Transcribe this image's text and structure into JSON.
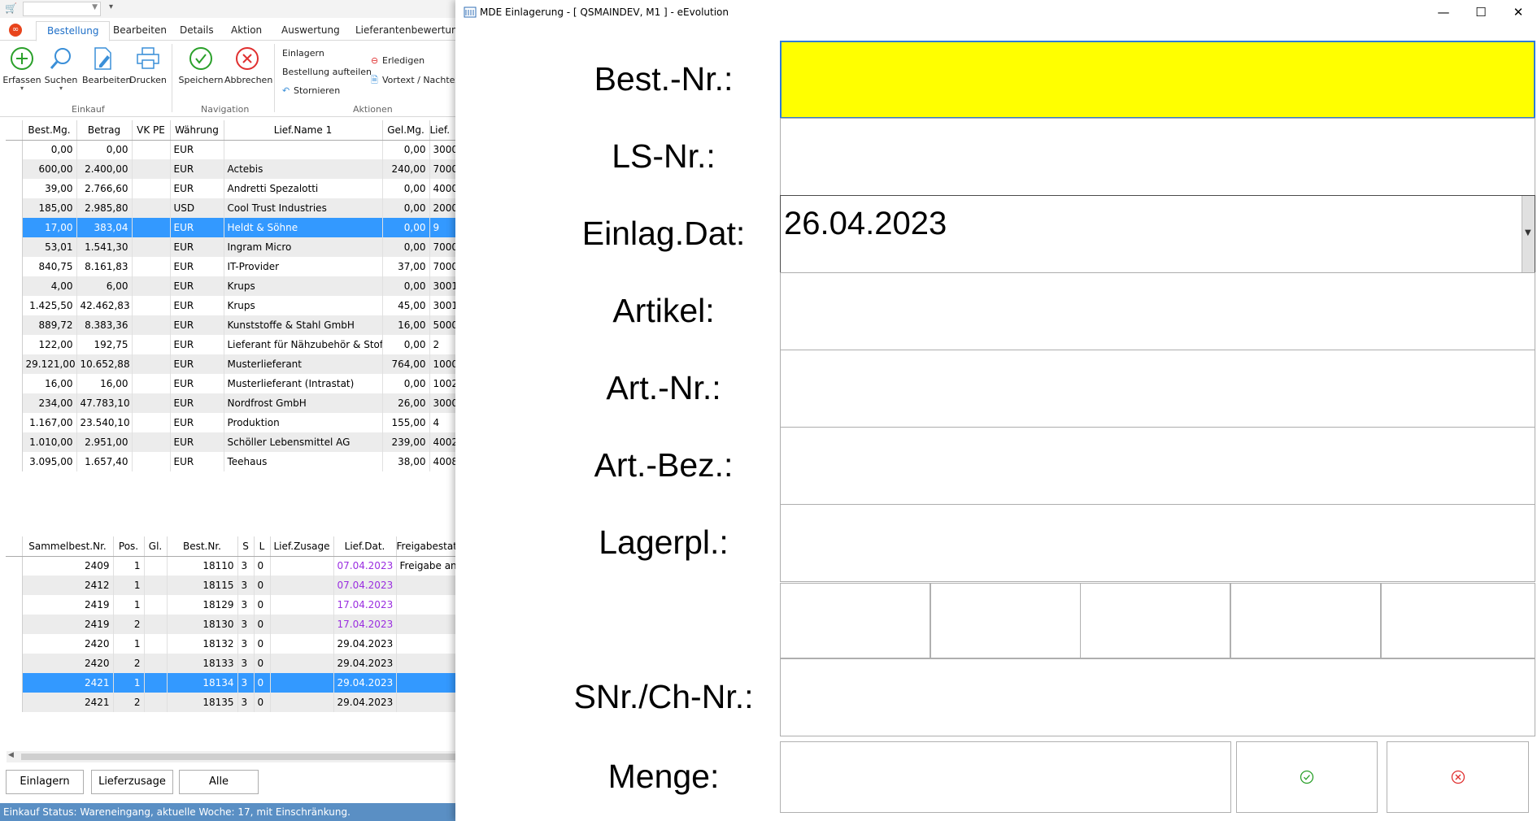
{
  "background_app": {
    "ribbon_tabs": [
      "Bestellung",
      "Bearbeiten",
      "Details",
      "Aktion",
      "Auswertung",
      "Lieferantenbewertung"
    ],
    "active_tab": "Bestellung",
    "ribbon": {
      "erfassen": "Erfassen",
      "suchen": "Suchen",
      "bearbeiten": "Bearbeiten",
      "drucken": "Drucken",
      "speichern": "Speichern",
      "abbrechen": "Abbrechen",
      "einlagern": "Einlagern",
      "bestellung_aufteilen": "Bestellung aufteilen",
      "stornieren": "Stornieren",
      "erledigen": "Erledigen",
      "vortext": "Vortext / Nachtext",
      "groups": {
        "einkauf": "Einkauf",
        "navigation": "Navigation",
        "aktionen": "Aktionen"
      }
    },
    "top_grid": {
      "columns": [
        "Best.Mg.",
        "Betrag",
        "VK PE",
        "Währung",
        "Lief.Name 1",
        "Gel.Mg.",
        "Lief."
      ],
      "rows": [
        [
          "0,00",
          "0,00",
          "",
          "EUR",
          "",
          "0,00",
          "3000"
        ],
        [
          "600,00",
          "2.400,00",
          "",
          "EUR",
          "Actebis",
          "240,00",
          "7000"
        ],
        [
          "39,00",
          "2.766,60",
          "",
          "EUR",
          "Andretti Spezalotti",
          "0,00",
          "4000"
        ],
        [
          "185,00",
          "2.985,80",
          "",
          "USD",
          "Cool Trust Industries",
          "0,00",
          "2000"
        ],
        [
          "17,00",
          "383,04",
          "",
          "EUR",
          "Heldt & Söhne",
          "0,00",
          "9"
        ],
        [
          "53,01",
          "1.541,30",
          "",
          "EUR",
          "Ingram Micro",
          "0,00",
          "7000"
        ],
        [
          "840,75",
          "8.161,83",
          "",
          "EUR",
          "IT-Provider",
          "37,00",
          "7000"
        ],
        [
          "4,00",
          "6,00",
          "",
          "EUR",
          "Krups",
          "0,00",
          "3001"
        ],
        [
          "1.425,50",
          "42.462,83",
          "",
          "EUR",
          "Krups",
          "45,00",
          "3001"
        ],
        [
          "889,72",
          "8.383,36",
          "",
          "EUR",
          "Kunststoffe & Stahl GmbH",
          "16,00",
          "5000"
        ],
        [
          "122,00",
          "192,75",
          "",
          "EUR",
          "Lieferant für Nähzubehör & Stoff",
          "0,00",
          "2"
        ],
        [
          "29.121,00",
          "10.652,88",
          "",
          "EUR",
          "Musterlieferant",
          "764,00",
          "1000"
        ],
        [
          "16,00",
          "16,00",
          "",
          "EUR",
          "Musterlieferant (Intrastat)",
          "0,00",
          "1002"
        ],
        [
          "234,00",
          "47.783,10",
          "",
          "EUR",
          "Nordfrost GmbH",
          "26,00",
          "3000"
        ],
        [
          "1.167,00",
          "23.540,10",
          "",
          "EUR",
          "Produktion",
          "155,00",
          "4"
        ],
        [
          "1.010,00",
          "2.951,00",
          "",
          "EUR",
          "Schöller Lebensmittel AG",
          "239,00",
          "4002"
        ],
        [
          "3.095,00",
          "1.657,40",
          "",
          "EUR",
          "Teehaus",
          "38,00",
          "4008"
        ]
      ],
      "selected_row": 4
    },
    "bottom_grid": {
      "columns": [
        "Sammelbest.Nr.",
        "Pos.",
        "Gl.",
        "Best.Nr.",
        "S",
        "L",
        "Lief.Zusage",
        "Lief.Dat.",
        "Freigabestatus"
      ],
      "rows": [
        [
          "2409",
          "1",
          "",
          "18110",
          "3",
          "0",
          "",
          "07.04.2023",
          "Freigabe angefordert"
        ],
        [
          "2412",
          "1",
          "",
          "18115",
          "3",
          "0",
          "",
          "07.04.2023",
          ""
        ],
        [
          "2419",
          "1",
          "",
          "18129",
          "3",
          "0",
          "",
          "17.04.2023",
          ""
        ],
        [
          "2419",
          "2",
          "",
          "18130",
          "3",
          "0",
          "",
          "17.04.2023",
          ""
        ],
        [
          "2420",
          "1",
          "",
          "18132",
          "3",
          "0",
          "",
          "29.04.2023",
          ""
        ],
        [
          "2420",
          "2",
          "",
          "18133",
          "3",
          "0",
          "",
          "29.04.2023",
          ""
        ],
        [
          "2421",
          "1",
          "",
          "18134",
          "3",
          "0",
          "",
          "29.04.2023",
          ""
        ],
        [
          "2421",
          "2",
          "",
          "18135",
          "3",
          "0",
          "",
          "29.04.2023",
          ""
        ]
      ],
      "purple_rows": [
        0,
        1,
        2,
        3
      ],
      "selected_row": 6
    },
    "buttons": {
      "einlagern": "Einlagern",
      "lieferzusage": "Lieferzusage",
      "alle": "Alle"
    },
    "status_text": "Einkauf Status: Wareneingang, aktuelle Woche: 17, mit Einschränkung."
  },
  "dialog": {
    "title": "MDE Einlagerung - [ QSMAINDEV, M1 ]  -  eEvolution",
    "labels": {
      "best_nr": "Best.-Nr.:",
      "ls_nr": "LS-Nr.:",
      "einlag_dat": "Einlag.Dat:",
      "artikel": "Artikel:",
      "art_nr": "Art.-Nr.:",
      "art_bez": "Art.-Bez.:",
      "lagerpl": "Lagerpl.:",
      "snr_ch_nr": "SNr./Ch-Nr.:",
      "menge": "Menge:"
    },
    "fields": {
      "best_nr": "",
      "ls_nr": "",
      "einlag_dat": "26.04.2023",
      "artikel": "",
      "art_nr": "",
      "art_bez": "",
      "lagerpl": "",
      "snr_ch_nr": "",
      "menge": ""
    },
    "colors": {
      "active_field": "#ffff00",
      "confirm": "#2aa02a",
      "cancel": "#e03030",
      "selection": "#3399ff"
    }
  }
}
